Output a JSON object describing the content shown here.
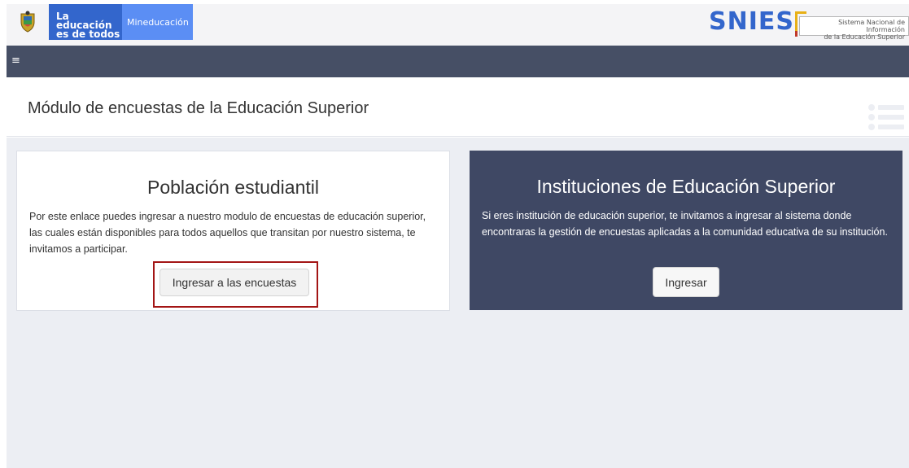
{
  "header": {
    "gov_line1": "La educación",
    "gov_line2": "es de todos",
    "ministry": "Mineducación",
    "snies_word": "SNIES",
    "snies_sub_line1": "Sistema Nacional de Información",
    "snies_sub_line2": "de la Educación Superior"
  },
  "nav": {
    "menu_icon": "≡"
  },
  "page": {
    "title": "Módulo de encuestas de la Educación Superior"
  },
  "cards": {
    "student": {
      "title": "Población estudiantil",
      "text": "Por este enlace puedes ingresar a nuestro modulo de encuestas de educación superior, las cuales están disponibles para todos aquellos que transitan por nuestro sistema, te invitamos a participar.",
      "button": "Ingresar a las encuestas"
    },
    "institutions": {
      "title": "Instituciones de Educación Superior",
      "text": "Si eres institución de educación superior, te invitamos a ingresar al sistema donde encontraras la gestión de encuestas aplicadas a la comunidad educativa de su institución.",
      "button": "Ingresar"
    }
  },
  "colors": {
    "gov_blue": "#3366cc",
    "ministry_blue": "#5b8ef4",
    "navbar": "#464f65",
    "institutions_card": "#3f4864",
    "highlight": "#a31515"
  }
}
